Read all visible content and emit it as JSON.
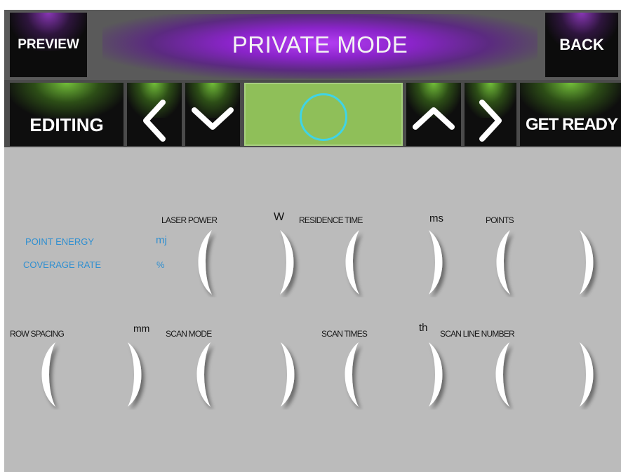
{
  "header": {
    "title": "PRIVATE MODE",
    "preview_label": "PREVIEW",
    "back_label": "BACK"
  },
  "toolbar": {
    "editing_label": "EDITING",
    "get_ready_label": "GET READY",
    "icons": [
      "chevron-left-icon",
      "chevron-down-icon",
      "ring-icon",
      "chevron-up-icon",
      "chevron-right-icon"
    ]
  },
  "info": {
    "point_energy_label": "POINT   ENERGY",
    "point_energy_unit": "mj",
    "coverage_rate_label": "COVERAGE RATE",
    "coverage_rate_unit": "%"
  },
  "params": {
    "laser_power": {
      "label": "LASER POWER",
      "unit": "W"
    },
    "residence_time": {
      "label": "RESIDENCE TIME",
      "unit": "ms"
    },
    "points": {
      "label": "POINTS",
      "unit": ""
    },
    "row_spacing": {
      "label": "ROW SPACING",
      "unit": "mm"
    },
    "scan_mode": {
      "label": "SCAN MODE",
      "unit": ""
    },
    "scan_times": {
      "label": "SCAN TIMES",
      "unit": "th"
    },
    "scan_line_number": {
      "label": "SCAN LINE NUMBER",
      "unit": ""
    }
  },
  "colors": {
    "background": "#bbbbbb",
    "title_glow": "#b53ef4",
    "active_green": "#8fbf59",
    "ring_cyan": "#3fd4e6",
    "info_blue": "#2f8fd0"
  }
}
